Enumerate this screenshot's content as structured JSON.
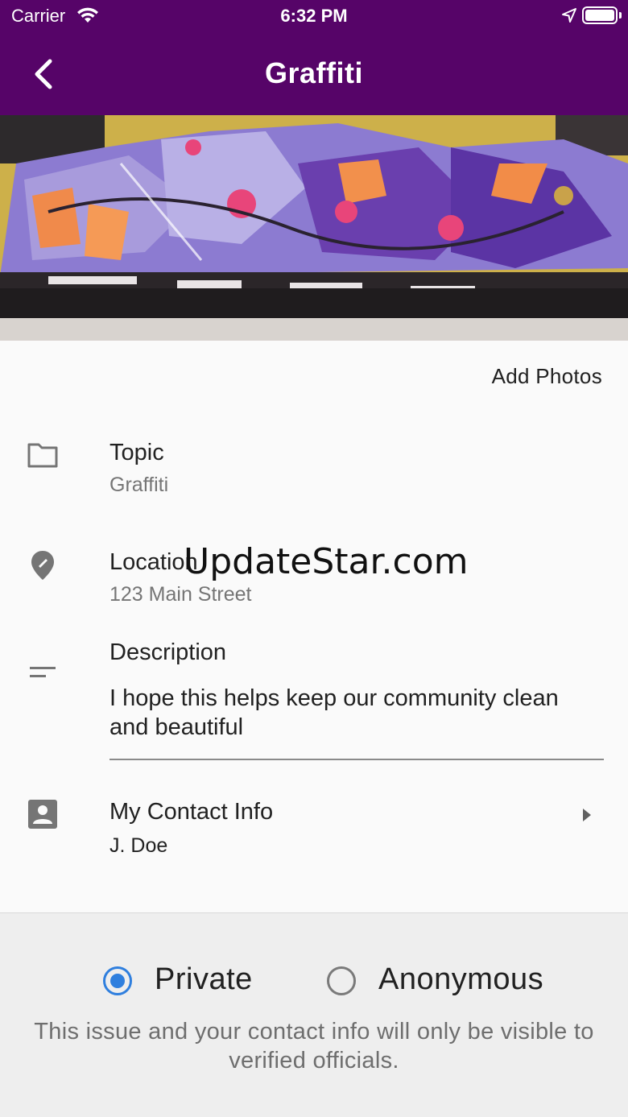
{
  "status_bar": {
    "carrier": "Carrier",
    "time": "6:32 PM"
  },
  "app_bar": {
    "title": "Graffiti"
  },
  "photos": {
    "add_label": "Add Photos"
  },
  "topic": {
    "label": "Topic",
    "value": "Graffiti"
  },
  "location": {
    "label": "Location",
    "value": "123 Main Street"
  },
  "description": {
    "label": "Description",
    "value": "I hope this helps keep our community clean and beautiful"
  },
  "contact": {
    "label": "My Contact Info",
    "value": "J. Doe"
  },
  "privacy": {
    "options": [
      {
        "label": "Private",
        "selected": true
      },
      {
        "label": "Anonymous",
        "selected": false
      }
    ],
    "note": "This issue and your contact info will only be visible to verified officials."
  },
  "watermark": "UpdateStar.com",
  "colors": {
    "primary": "#560468",
    "radio_selected": "#2f7fde",
    "panel_bg": "#eeeeee"
  },
  "icons": [
    "wifi-icon",
    "location-arrow-icon",
    "battery-icon",
    "back-icon",
    "folder-icon",
    "map-pin-icon",
    "description-lines-icon",
    "contact-card-icon",
    "chevron-right-icon"
  ]
}
